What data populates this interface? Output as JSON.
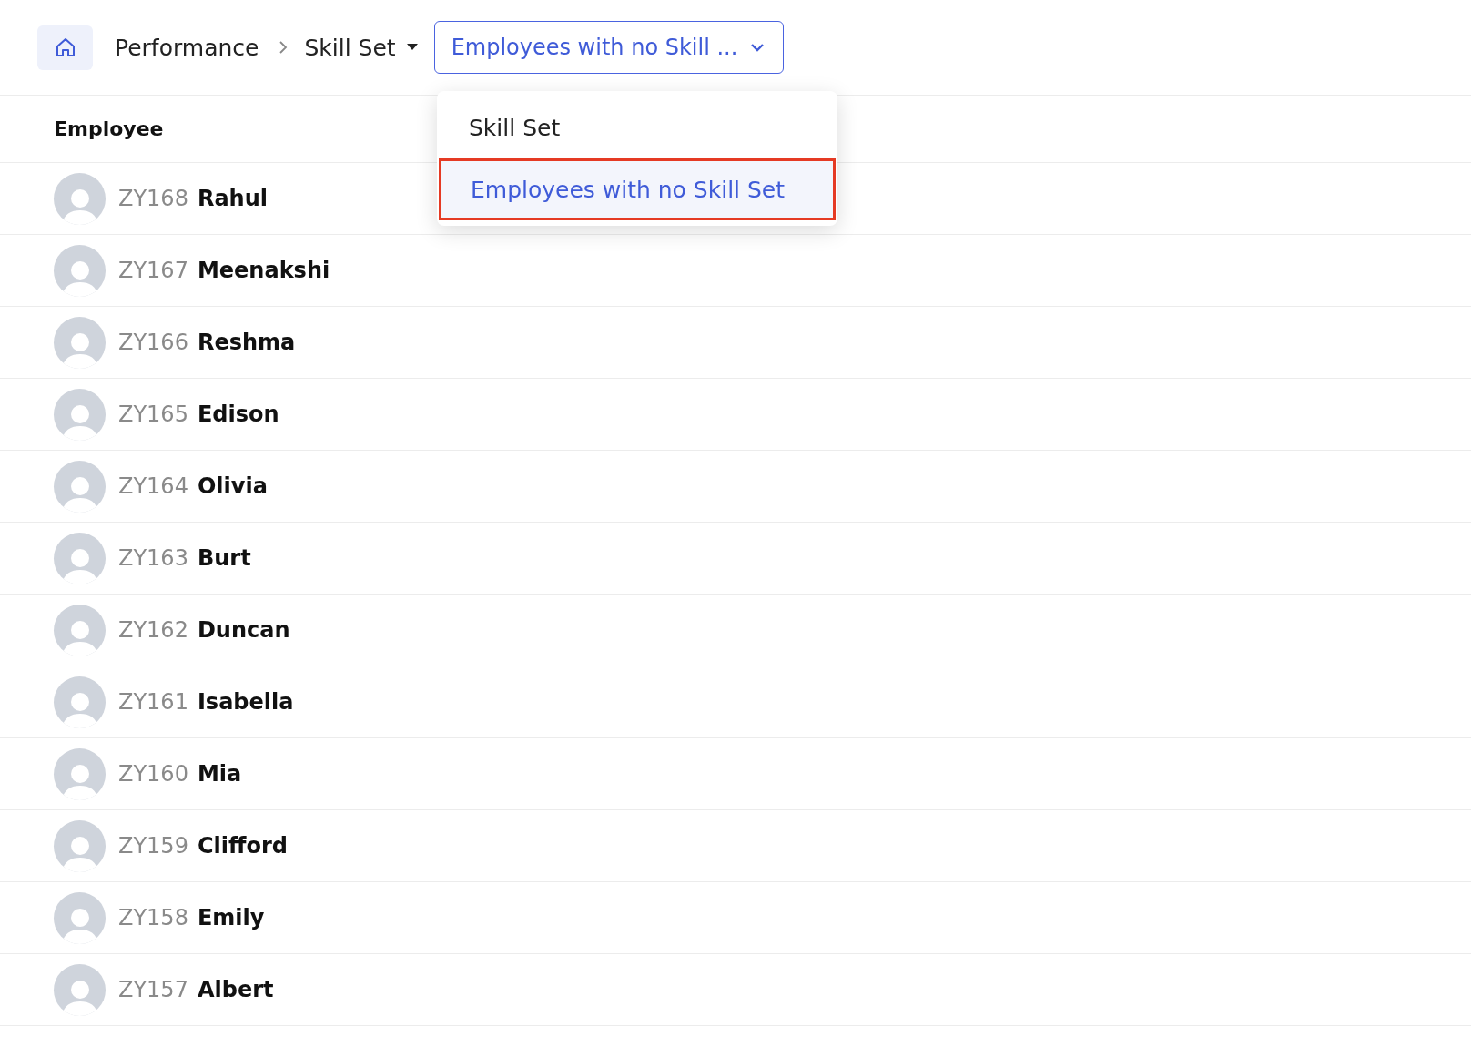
{
  "breadcrumb": {
    "items": [
      {
        "label": "Performance",
        "kind": "link"
      },
      {
        "label": "Skill Set",
        "kind": "menu"
      }
    ]
  },
  "view_dropdown": {
    "value": "Employees with no Skill ...",
    "expanded": true,
    "options": [
      {
        "label": "Skill Set",
        "selected": false
      },
      {
        "label": "Employees with no Skill Set",
        "selected": true
      }
    ]
  },
  "table": {
    "columns": [
      "Employee"
    ],
    "rows": [
      {
        "id": "ZY168",
        "name": "Rahul"
      },
      {
        "id": "ZY167",
        "name": "Meenakshi"
      },
      {
        "id": "ZY166",
        "name": "Reshma"
      },
      {
        "id": "ZY165",
        "name": "Edison"
      },
      {
        "id": "ZY164",
        "name": "Olivia"
      },
      {
        "id": "ZY163",
        "name": "Burt"
      },
      {
        "id": "ZY162",
        "name": "Duncan"
      },
      {
        "id": "ZY161",
        "name": "Isabella"
      },
      {
        "id": "ZY160",
        "name": "Mia"
      },
      {
        "id": "ZY159",
        "name": "Clifford"
      },
      {
        "id": "ZY158",
        "name": "Emily"
      },
      {
        "id": "ZY157",
        "name": "Albert"
      }
    ]
  }
}
